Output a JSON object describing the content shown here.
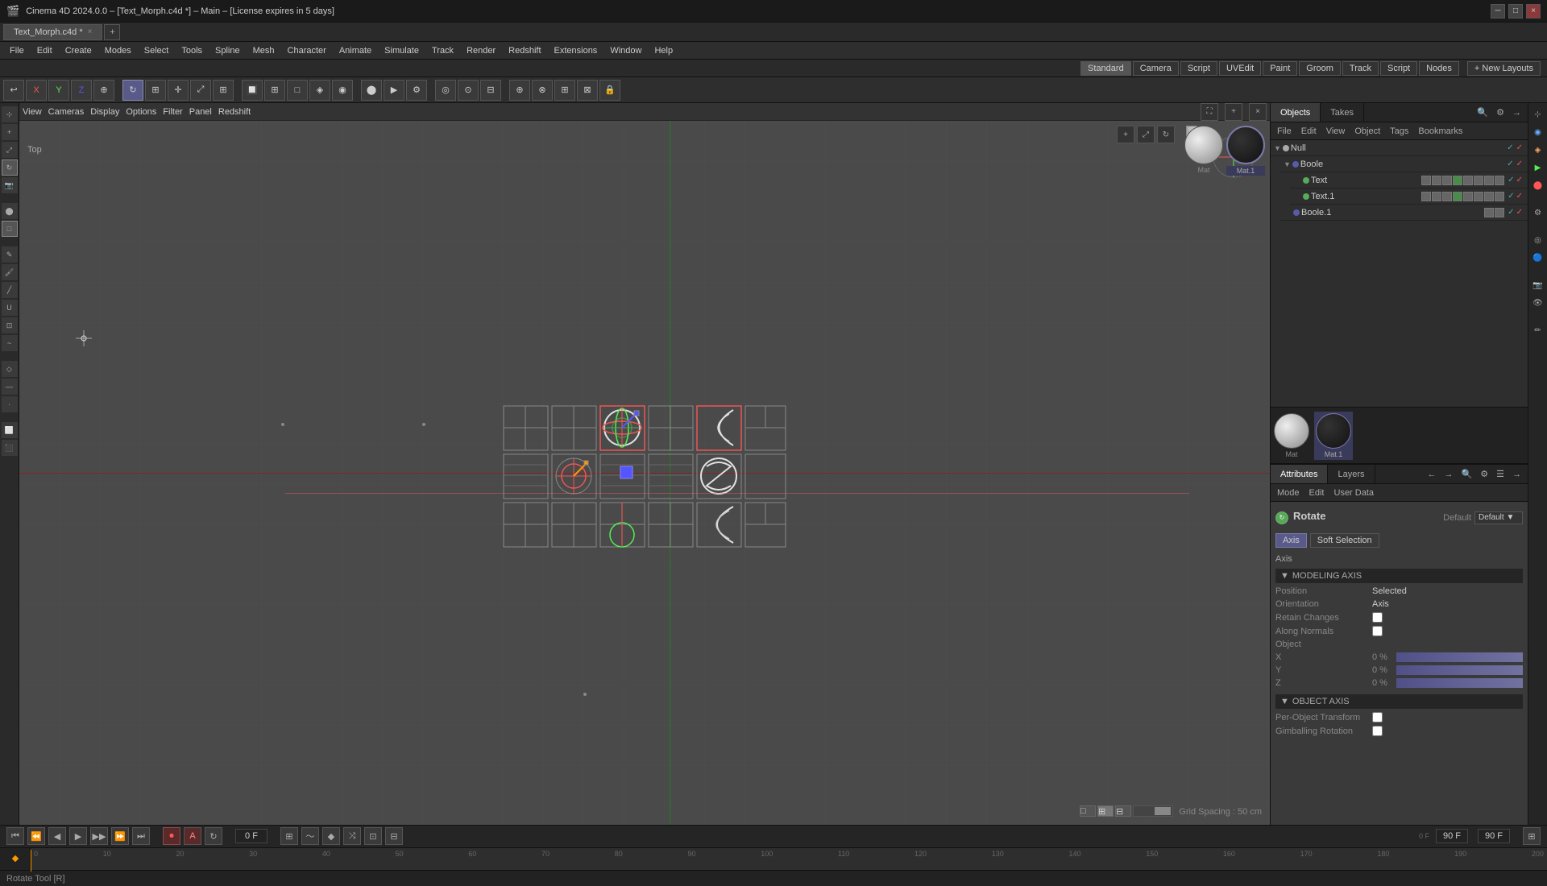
{
  "app": {
    "title": "Cinema 4D 2024.0.0 – [Text_Morph.c4d *] – Main – [License expires in 5 days]",
    "tab_name": "Text_Morph.c4d *",
    "license_warning": "License expires in 5 days"
  },
  "window_controls": {
    "minimize": "─",
    "restore": "□",
    "close": "×"
  },
  "menu": {
    "items": [
      "File",
      "Edit",
      "Create",
      "Modes",
      "Select",
      "Tools",
      "Spline",
      "Mesh",
      "Character",
      "Animate",
      "Simulate",
      "Track",
      "Render",
      "Redshift",
      "Extensions",
      "Window",
      "Help"
    ]
  },
  "layout_presets": [
    "Standard",
    "Camera",
    "Script",
    "UVEdit",
    "Paint",
    "Groom",
    "Track",
    "Script",
    "Nodes",
    "New Layouts"
  ],
  "toolbar": {
    "tools": [
      "⬦",
      "X",
      "Y",
      "Z",
      "↺",
      "",
      "",
      "",
      "",
      "",
      "",
      "",
      "",
      "",
      "",
      "",
      "",
      "",
      "",
      "",
      "",
      "",
      "",
      "",
      "",
      "",
      "",
      "",
      "",
      ""
    ]
  },
  "viewport": {
    "label": "Top",
    "menu_items": [
      "View",
      "Cameras",
      "Display",
      "Options",
      "Filter",
      "Panel",
      "Redshift"
    ],
    "grid_spacing": "Grid Spacing : 50 cm",
    "view_mode": "Top"
  },
  "objects_panel": {
    "tabs": [
      "Objects",
      "Takes"
    ],
    "toolbar_items": [
      "File",
      "Edit",
      "View",
      "Object",
      "Tags",
      "Bookmarks"
    ],
    "objects": [
      {
        "name": "Null",
        "depth": 0,
        "type": "null",
        "visible": true,
        "locked": false,
        "tags": []
      },
      {
        "name": "Boole",
        "depth": 1,
        "type": "boole",
        "visible": true,
        "locked": false,
        "tags": []
      },
      {
        "name": "Text",
        "depth": 2,
        "type": "text",
        "visible": true,
        "locked": false,
        "tags": [
          "tag1",
          "tag2",
          "tag3",
          "tag4",
          "tag5",
          "tag6",
          "tag7",
          "tag8"
        ]
      },
      {
        "name": "Text.1",
        "depth": 2,
        "type": "text",
        "visible": true,
        "locked": false,
        "tags": [
          "tag1",
          "tag2",
          "tag3",
          "tag4",
          "tag5",
          "tag6",
          "tag7",
          "tag8"
        ]
      },
      {
        "name": "Boole.1",
        "depth": 1,
        "type": "boole",
        "visible": true,
        "locked": false,
        "tags": [
          "tag1",
          "tag2"
        ]
      }
    ]
  },
  "materials": {
    "items": [
      {
        "name": "Mat",
        "type": "grey"
      },
      {
        "name": "Mat.1",
        "type": "dark",
        "active": true
      }
    ]
  },
  "attributes_panel": {
    "tabs": [
      "Attributes",
      "Layers"
    ],
    "toolbar_items": [
      "Mode",
      "Edit",
      "User Data"
    ],
    "title": "Rotate",
    "sub_tabs": [
      "Axis",
      "Soft Selection"
    ],
    "sections": {
      "axis_label": "Axis",
      "modeling_axis": "MODELING AXIS",
      "position_label": "Position",
      "position_value": "Selected",
      "orientation_label": "Orientation",
      "orientation_value": "Axis",
      "retain_changes_label": "Retain Changes",
      "along_normals_label": "Along Normals",
      "object_label": "Object",
      "x_label": "X",
      "x_value": "0 %",
      "y_label": "Y",
      "y_value": "0 %",
      "z_label": "Z",
      "z_value": "0 %",
      "object_axis_label": "OBJECT AXIS",
      "per_object_transform_label": "Per-Object Transform",
      "gimballing_rotation_label": "Gimballing Rotation"
    }
  },
  "timeline": {
    "frame_current": "0 F",
    "frame_end": "90 F",
    "frame_start": "0 F",
    "frame_end_display": "90 F",
    "marks": [
      "0",
      "10",
      "20",
      "30",
      "40",
      "50",
      "60",
      "70",
      "80",
      "90",
      "100",
      "110",
      "120",
      "130",
      "140",
      "150",
      "160",
      "170",
      "180",
      "190",
      "200"
    ],
    "frame_counter": "0 F"
  },
  "statusbar": {
    "text": "Rotate Tool [R]"
  },
  "soft_selection": "Soft Selection",
  "track_label": "Track"
}
